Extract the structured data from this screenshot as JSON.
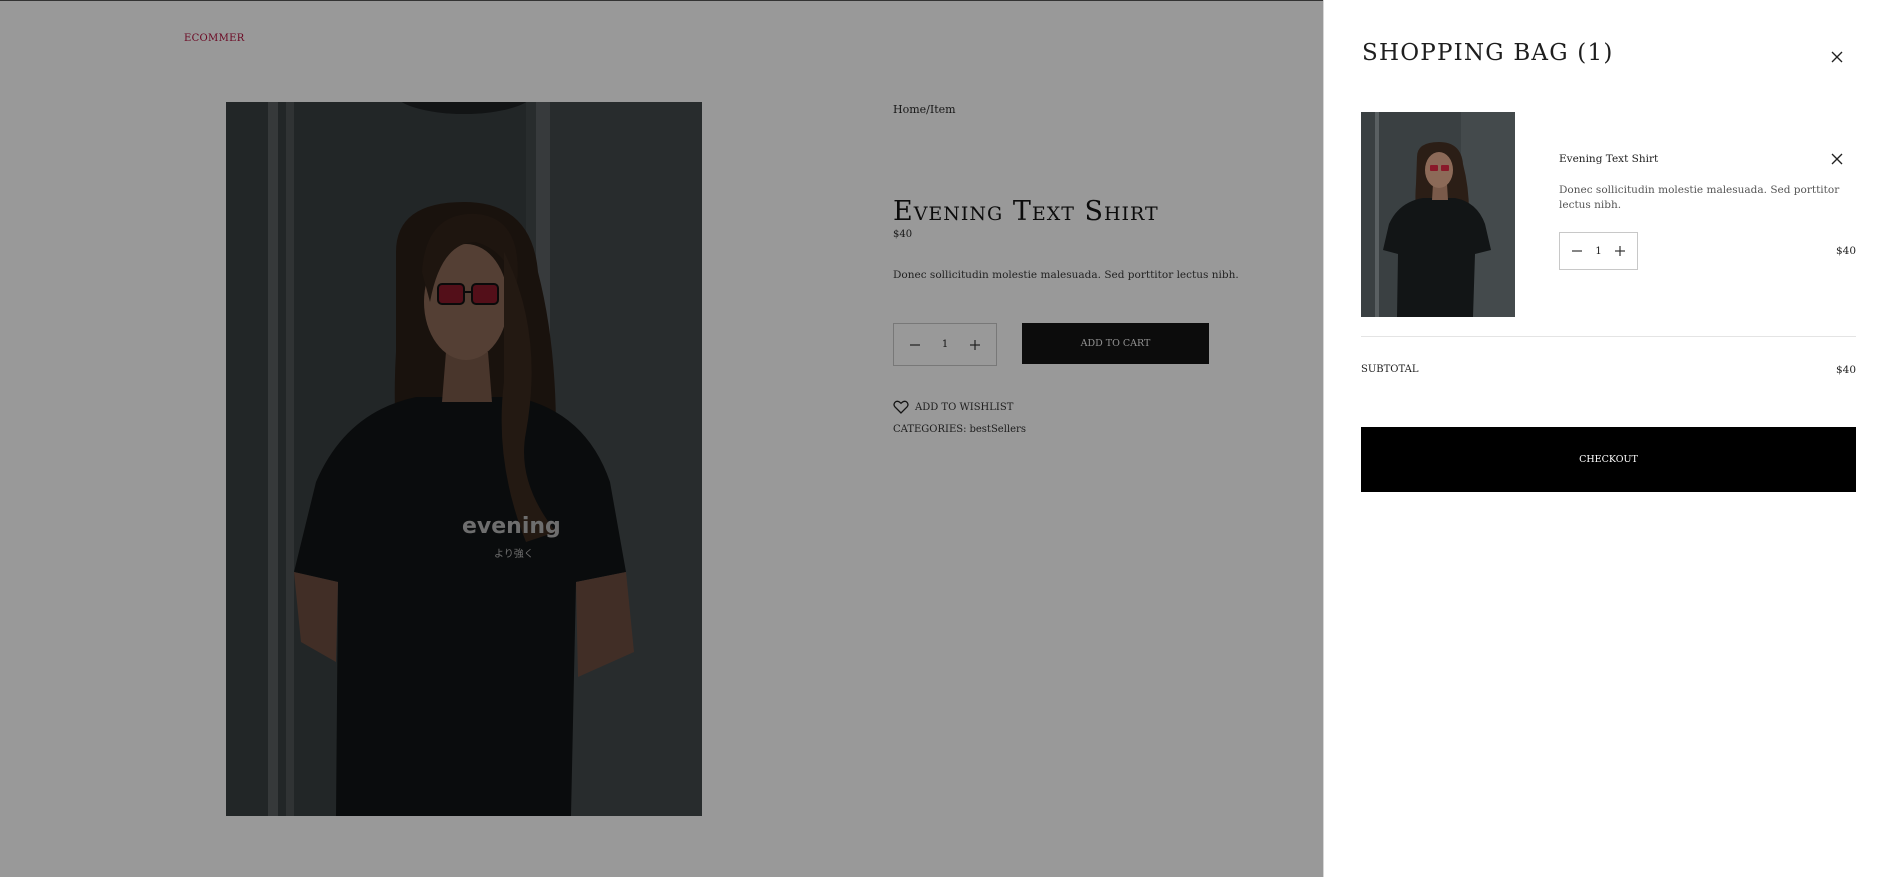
{
  "brand": {
    "logo_text": "ECOMMER"
  },
  "breadcrumb": {
    "home": "Home",
    "separator": "/",
    "current": "Item"
  },
  "product": {
    "title": "Evening Text Shirt",
    "price": "$40",
    "description": "Donec sollicitudin molestie malesuada. Sed porttitor lectus nibh.",
    "quantity": "1",
    "add_to_cart_label": "ADD TO CART",
    "wishlist_label": "ADD TO WISHLIST",
    "categories_label": "CATEGORIES:",
    "category": "bestSellers",
    "shirt_print": "evening",
    "shirt_print_jp": "より強く"
  },
  "cart": {
    "title": "SHOPPING BAG (1)",
    "items": [
      {
        "name": "Evening Text Shirt",
        "description": "Donec sollicitudin molestie malesuada. Sed porttitor lectus nibh.",
        "quantity": "1",
        "price": "$40"
      }
    ],
    "subtotal_label": "SUBTOTAL",
    "subtotal_value": "$40",
    "checkout_label": "CHECKOUT"
  },
  "icons": {
    "close": "close-icon",
    "minus": "minus-icon",
    "plus": "plus-icon",
    "heart": "heart-icon"
  },
  "colors": {
    "brand": "#b3103c",
    "button_dark": "#151515",
    "checkout_bg": "#000000",
    "overlay": "rgba(0,0,0,0.40)"
  }
}
